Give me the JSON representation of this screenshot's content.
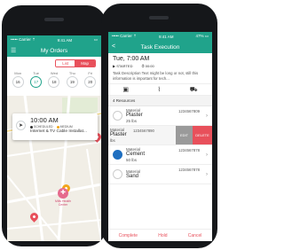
{
  "colors": {
    "accent": "#20a38b",
    "alert": "#e8505b",
    "warning": "#f2a51a",
    "complete": "#1f6fc0"
  },
  "left_phone": {
    "status": {
      "carrier": "••••• Carrier ⇡",
      "time": "9:41 AM",
      "battery": "▭"
    },
    "nav": {
      "menu_icon": "hamburger-icon",
      "title": "My Orders"
    },
    "view_toggle": {
      "list": "List",
      "map": "Map",
      "active": "Map"
    },
    "days": [
      {
        "name": "Mon",
        "num": "16"
      },
      {
        "name": "Tue",
        "num": "17"
      },
      {
        "name": "Wed",
        "num": "18"
      },
      {
        "name": "Thu",
        "num": "19"
      },
      {
        "name": "Fri",
        "num": "20"
      }
    ],
    "map_card": {
      "time": "10:00 AM",
      "scheduled": "SCHEDULED",
      "priority": "MEDIUM",
      "description": "Internet & TV Cable Installat..."
    },
    "landmark": {
      "name": "Mills Health Center",
      "line1": "Mills Health",
      "line2": "Center"
    }
  },
  "right_phone": {
    "status": {
      "carrier": "••••• Carrier ⇡",
      "time": "9:41 AM",
      "battery": "47% ▭"
    },
    "nav": {
      "back": "<",
      "title": "Task Execution"
    },
    "task": {
      "time": "Tue, 7:00 AM",
      "status": "STARTED",
      "duration": "00:00",
      "description": "Task Description Text might be long or not, still this information is important for tech..."
    },
    "toolbar_icons": [
      "save-icon",
      "attachment-icon",
      "truck-icon"
    ],
    "resources_header": "4 Resources",
    "resources": [
      {
        "type": "Material",
        "name": "Plaster",
        "qty": "25 lbs",
        "code": "1234567809",
        "done": false
      },
      {
        "type": "Material",
        "name": "Plaster",
        "qty": "lbs",
        "code": "1234567890",
        "swiped": true
      },
      {
        "type": "Material",
        "name": "Cement",
        "qty": "50 lbs",
        "code": "1234567878",
        "done": true
      },
      {
        "type": "Material",
        "name": "Sand",
        "qty": "",
        "code": "1234567878",
        "done": false
      }
    ],
    "swipe_actions": {
      "edit": "EDIT",
      "delete": "DELETE"
    },
    "action_bar": {
      "complete": "Complete",
      "hold": "Hold",
      "cancel": "Cancel"
    }
  }
}
